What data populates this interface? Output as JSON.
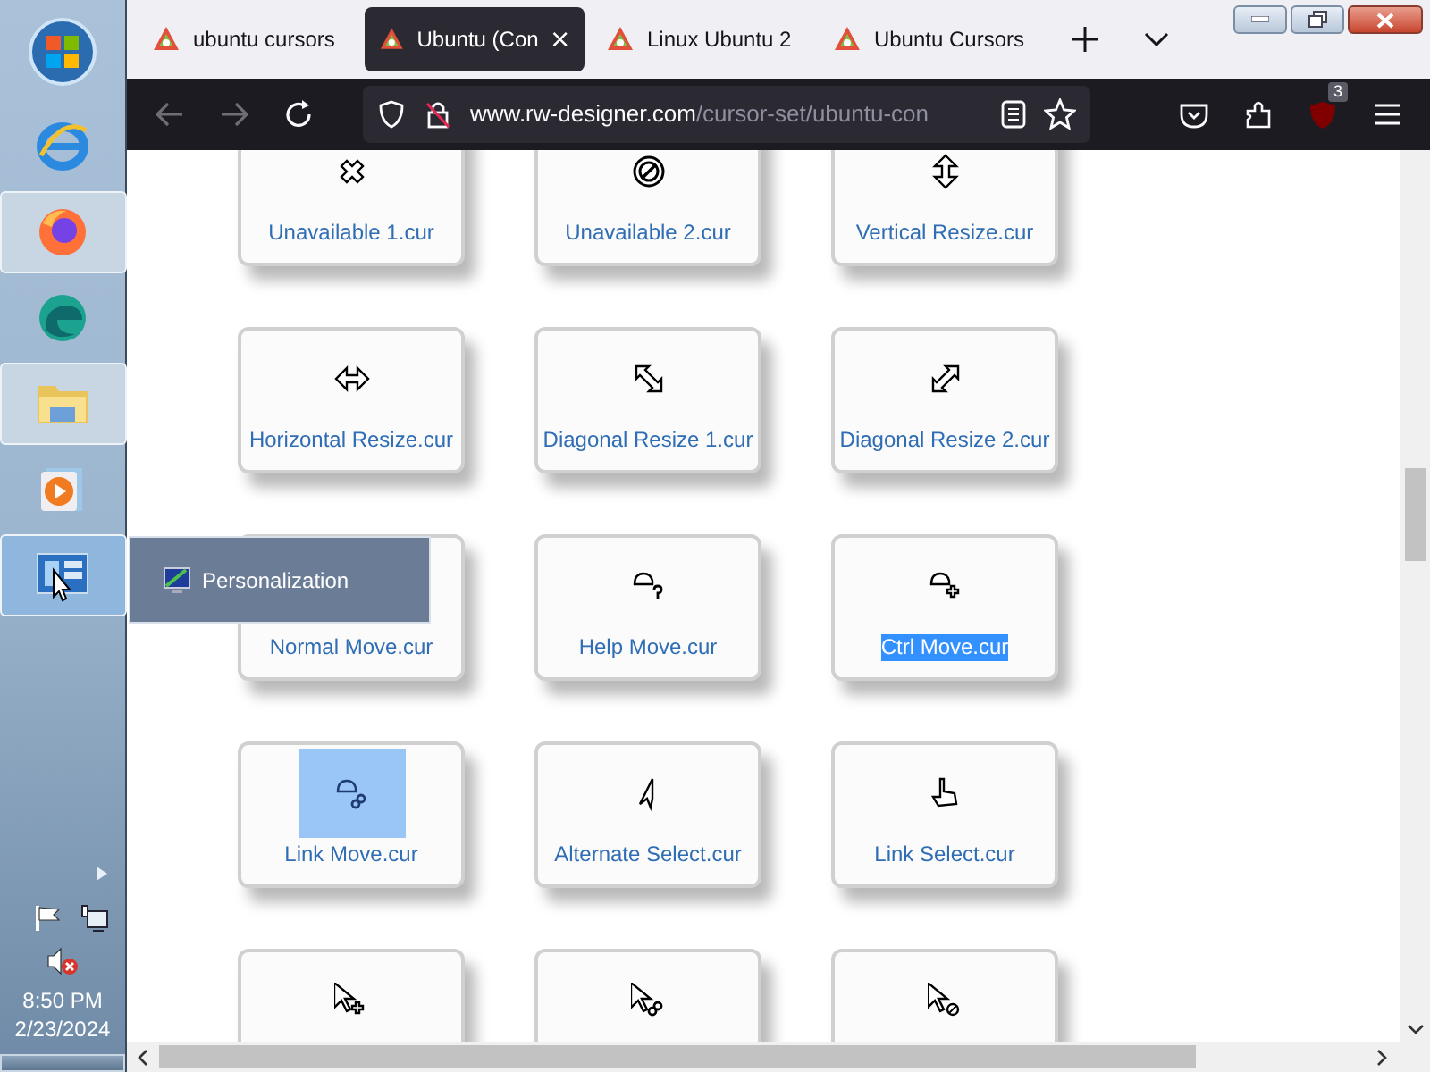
{
  "taskbar": {
    "pinned": [
      {
        "kind": "ie",
        "running": false,
        "hovered": false
      },
      {
        "kind": "firefox",
        "running": true,
        "hovered": false
      },
      {
        "kind": "edge",
        "running": false,
        "hovered": false
      },
      {
        "kind": "explorer",
        "running": true,
        "hovered": false
      },
      {
        "kind": "media",
        "running": false,
        "hovered": false
      },
      {
        "kind": "control",
        "running": true,
        "hovered": true
      }
    ],
    "tooltip": {
      "label": "Personalization"
    },
    "tray": {
      "time": "8:50 PM",
      "date": "2/23/2024"
    }
  },
  "browser": {
    "tabs": [
      {
        "title": "ubuntu cursors",
        "selected": false
      },
      {
        "title": "Ubuntu (Con",
        "selected": true
      },
      {
        "title": "Linux Ubuntu 2",
        "selected": false
      },
      {
        "title": "Ubuntu Cursors",
        "selected": false
      }
    ],
    "url_domain": "www.rw-designer.com",
    "url_path": "/cursor-set/ubuntu-con",
    "addon_badge": "3"
  },
  "cursors": [
    {
      "name": "Unavailable 1.cur",
      "kind": "cross",
      "label_selected": false,
      "icon_selected": false
    },
    {
      "name": "Unavailable 2.cur",
      "kind": "no",
      "label_selected": false,
      "icon_selected": false
    },
    {
      "name": "Vertical Resize.cur",
      "kind": "vresize",
      "label_selected": false,
      "icon_selected": false
    },
    {
      "name": "Horizontal Resize.cur",
      "kind": "hresize",
      "label_selected": false,
      "icon_selected": false
    },
    {
      "name": "Diagonal Resize 1.cur",
      "kind": "dresize1",
      "label_selected": false,
      "icon_selected": false
    },
    {
      "name": "Diagonal Resize 2.cur",
      "kind": "dresize2",
      "label_selected": false,
      "icon_selected": false
    },
    {
      "name": "Normal Move.cur",
      "label_selected": false,
      "icon_selected": false
    },
    {
      "name": "Help Move.cur",
      "kind": "movehelp",
      "label_selected": false,
      "icon_selected": false
    },
    {
      "name": "Ctrl Move.cur",
      "kind": "moveplus",
      "label_selected": true,
      "icon_selected": false
    },
    {
      "name": "Link Move.cur",
      "kind": "movelink",
      "label_selected": false,
      "icon_selected": true
    },
    {
      "name": "Alternate Select.cur",
      "kind": "alt",
      "label_selected": false,
      "icon_selected": false
    },
    {
      "name": "Link Select.cur",
      "kind": "hand",
      "label_selected": false,
      "icon_selected": false
    },
    {
      "kind": "arrowplus",
      "icon_selected": false
    },
    {
      "kind": "arrowlink",
      "icon_selected": false
    },
    {
      "kind": "arrowno",
      "icon_selected": false
    }
  ]
}
